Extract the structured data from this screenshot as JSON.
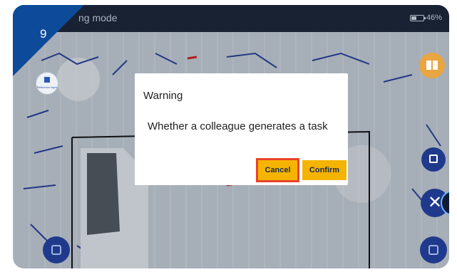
{
  "step": {
    "number": "9"
  },
  "header": {
    "mode_label": "ng mode",
    "battery_percent": "46%",
    "battery_level": 0.46
  },
  "reference_layer": {
    "label": "Reference layer"
  },
  "dialog": {
    "title": "Warning",
    "message": "Whether a colleague generates a task",
    "cancel_label": "Cancel",
    "confirm_label": "Confirm"
  },
  "icons": {
    "book": "book-icon",
    "save": "save-icon",
    "close": "close-icon",
    "menu": "menu-icon"
  },
  "colors": {
    "accent_button": "#f5b400",
    "highlight_outline": "#e8432b",
    "step_badge": "#0d4a9a",
    "fab_blue": "#1f3a8c",
    "fab_orange": "#e9a53f"
  }
}
